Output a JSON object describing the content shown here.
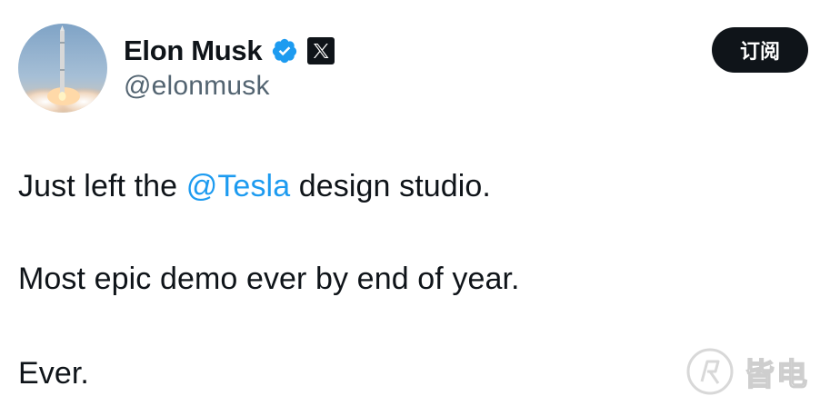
{
  "tweet": {
    "author": {
      "display_name": "Elon Musk",
      "handle": "@elonmusk",
      "verified_icon": "verified-badge-icon",
      "affiliate_icon": "x-logo-icon"
    },
    "subscribe_label": "订阅",
    "text": {
      "line1_before": "Just left the ",
      "line1_mention": "@Tesla",
      "line1_after": " design studio.",
      "line2": "Most epic demo ever by end of year.",
      "line3": "Ever."
    }
  },
  "watermark": {
    "text": "皆电"
  },
  "colors": {
    "text": "#0f1419",
    "secondary_text": "#536471",
    "link": "#1d9bf0",
    "verified_blue": "#1d9bf0",
    "button_bg": "#0f1419"
  }
}
